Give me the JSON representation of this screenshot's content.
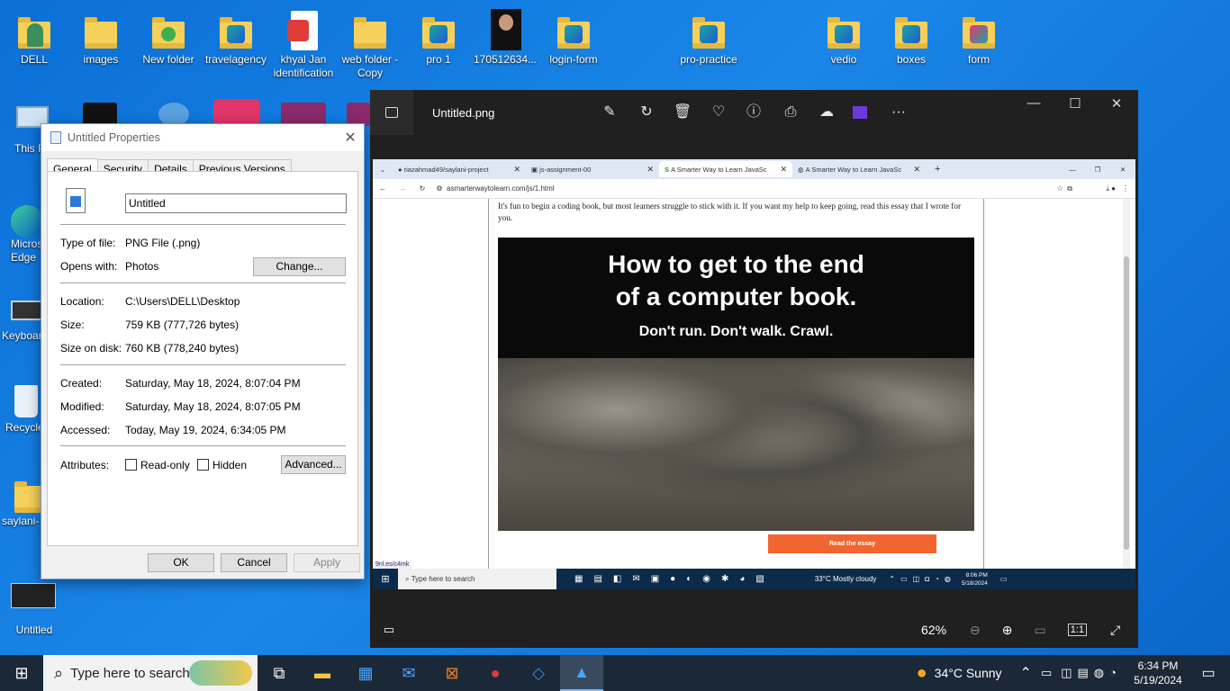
{
  "desktop": {
    "icons": [
      {
        "label": "DELL",
        "kind": "user"
      },
      {
        "label": "images",
        "kind": "folder"
      },
      {
        "label": "New folder",
        "kind": "folder"
      },
      {
        "label": "travelagency",
        "kind": "vscode-folder"
      },
      {
        "label": "khyal Jan identification",
        "kind": "pdf"
      },
      {
        "label": "web folder - Copy",
        "kind": "folder"
      },
      {
        "label": "pro 1",
        "kind": "vscode-folder"
      },
      {
        "label": "170512634...",
        "kind": "photo"
      },
      {
        "label": "login-form",
        "kind": "vscode-folder"
      },
      {
        "label": "pro-practice",
        "kind": "vscode-folder"
      },
      {
        "label": "vedio",
        "kind": "vscode-folder"
      },
      {
        "label": "boxes",
        "kind": "vscode-folder"
      },
      {
        "label": "form",
        "kind": "vscode-folder"
      },
      {
        "label": "This PC",
        "kind": "pc"
      },
      {
        "label": "Microsoft Edge",
        "kind": "edge"
      },
      {
        "label": "Keyboard",
        "kind": "keyboard"
      },
      {
        "label": "Recycle Bin",
        "kind": "recycle"
      },
      {
        "label": "saylani-",
        "kind": "folder"
      },
      {
        "label": "Untitled",
        "kind": "image"
      }
    ]
  },
  "props": {
    "title": "Untitled Properties",
    "tabs": [
      "General",
      "Security",
      "Details",
      "Previous Versions"
    ],
    "filename": "Untitled",
    "type_label": "Type of file:",
    "type_value": "PNG File (.png)",
    "opens_label": "Opens with:",
    "opens_value": "Photos",
    "change": "Change...",
    "location_label": "Location:",
    "location_value": "C:\\Users\\DELL\\Desktop",
    "size_label": "Size:",
    "size_value": "759 KB (777,726 bytes)",
    "disk_label": "Size on disk:",
    "disk_value": "760 KB (778,240 bytes)",
    "created_label": "Created:",
    "created_value": "Saturday, May 18, 2024, 8:07:04 PM",
    "modified_label": "Modified:",
    "modified_value": "Saturday, May 18, 2024, 8:07:05 PM",
    "accessed_label": "Accessed:",
    "accessed_value": "Today, May 19, 2024, 6:34:05 PM",
    "attributes_label": "Attributes:",
    "readonly": "Read-only",
    "hidden": "Hidden",
    "advanced": "Advanced...",
    "ok": "OK",
    "cancel": "Cancel",
    "apply": "Apply"
  },
  "photos": {
    "filename": "Untitled.png",
    "zoom": "62%",
    "tabs": [
      "riazahmad49/saylani-project",
      "js-assignment-00",
      "A Smarter Way to Learn JavaSc",
      "A Smarter Way to Learn JavaSc"
    ],
    "url": "asmarterwaytolearn.com/js/1.html",
    "intro": "It's fun to begin a coding book, but most learners struggle to stick with it. If you want my help to keep going, read this essay that I wrote for you.",
    "hero1": "How to get to the end",
    "hero2": "of a computer book.",
    "hero3": "Don't run. Don't walk. Crawl.",
    "read_btn": "Read the essay",
    "status": "9nl.es/c4mk",
    "inner_search": "Type here to search",
    "inner_weather": "33°C  Mostly cloudy",
    "inner_time": "8:06 PM",
    "inner_date": "5/18/2024"
  },
  "taskbar": {
    "search": "Type here to search",
    "weather": "34°C  Sunny",
    "time": "6:34 PM",
    "date": "5/19/2024"
  }
}
